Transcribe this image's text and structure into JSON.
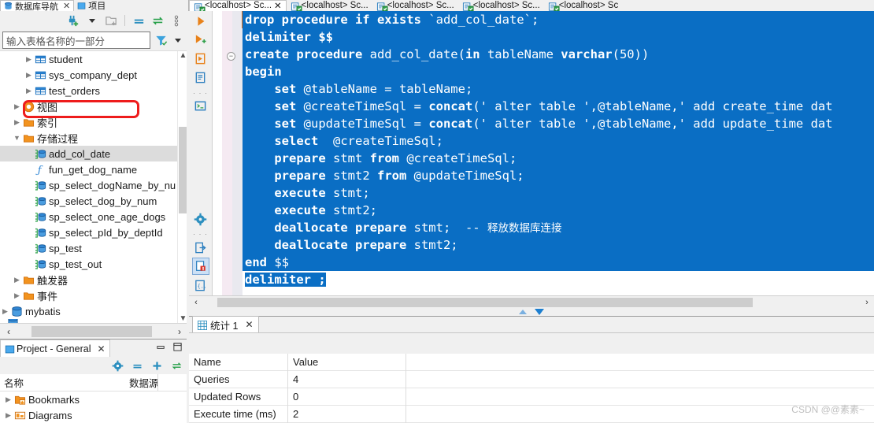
{
  "window": {
    "watermark": "CSDN @@素素~"
  },
  "db_navigator": {
    "tabs": [
      {
        "label": "数据库导航",
        "icon": "database-navigator-icon",
        "active": true,
        "closable": true
      },
      {
        "label": "项目",
        "icon": "project-icon",
        "active": false,
        "closable": false
      }
    ],
    "toolbar": [
      {
        "name": "new-connection-icon",
        "glyph": "plug-plus"
      },
      {
        "name": "dropdown-arrow-icon",
        "glyph": "caret-down"
      },
      {
        "name": "new-folder-icon",
        "glyph": "folder-plus"
      },
      {
        "name": "collapse-all-icon",
        "glyph": "minus-bars"
      },
      {
        "name": "refresh-icon",
        "glyph": "swap-arrows"
      },
      {
        "name": "view-menu-icon",
        "glyph": "vertical-dots"
      }
    ],
    "filter": {
      "placeholder": "输入表格名称的一部分",
      "value": "",
      "filter_icon": "funnel-icon",
      "dropdown_icon": "caret-down-icon"
    },
    "tree": [
      {
        "label": "student",
        "indent": 3,
        "arrow": "closed",
        "icon": "table-icon",
        "selected": false
      },
      {
        "label": "sys_company_dept",
        "indent": 3,
        "arrow": "closed",
        "icon": "table-icon",
        "selected": false
      },
      {
        "label": "test_orders",
        "indent": 3,
        "arrow": "closed",
        "icon": "table-icon",
        "selected": false
      },
      {
        "label": "视图",
        "indent": 2,
        "arrow": "closed",
        "icon": "view-icon",
        "selected": false
      },
      {
        "label": "索引",
        "indent": 2,
        "arrow": "closed",
        "icon": "folder-icon",
        "selected": false
      },
      {
        "label": "存储过程",
        "indent": 2,
        "arrow": "open",
        "icon": "folder-icon",
        "selected": false
      },
      {
        "label": "add_col_date",
        "indent": 3,
        "arrow": "none",
        "icon": "procedure-icon",
        "selected": true
      },
      {
        "label": "fun_get_dog_name",
        "indent": 3,
        "arrow": "none",
        "icon": "function-icon",
        "selected": false
      },
      {
        "label": "sp_select_dogName_by_nu",
        "indent": 3,
        "arrow": "none",
        "icon": "procedure-icon",
        "selected": false
      },
      {
        "label": "sp_select_dog_by_num",
        "indent": 3,
        "arrow": "none",
        "icon": "procedure-icon",
        "selected": false
      },
      {
        "label": "sp_select_one_age_dogs",
        "indent": 3,
        "arrow": "none",
        "icon": "procedure-icon",
        "selected": false
      },
      {
        "label": "sp_select_pId_by_deptId",
        "indent": 3,
        "arrow": "none",
        "icon": "procedure-icon",
        "selected": false
      },
      {
        "label": "sp_test",
        "indent": 3,
        "arrow": "none",
        "icon": "procedure-icon",
        "selected": false
      },
      {
        "label": "sp_test_out",
        "indent": 3,
        "arrow": "none",
        "icon": "procedure-icon",
        "selected": false
      },
      {
        "label": "触发器",
        "indent": 2,
        "arrow": "closed",
        "icon": "folder-icon",
        "selected": false
      },
      {
        "label": "事件",
        "indent": 2,
        "arrow": "closed",
        "icon": "folder-icon",
        "selected": false
      },
      {
        "label": "mybatis",
        "indent": 1,
        "arrow": "closed",
        "icon": "database-icon",
        "selected": false
      }
    ]
  },
  "project_panel": {
    "tab": {
      "label": "Project - General",
      "icon": "project-icon",
      "closable": true
    },
    "window_buttons": [
      {
        "name": "minimize-button",
        "glyph": "minimize"
      },
      {
        "name": "maximize-button",
        "glyph": "maximize"
      }
    ],
    "toolbar": [
      {
        "name": "settings-gear-icon",
        "glyph": "gear"
      },
      {
        "name": "collapse-all-icon",
        "glyph": "minus-bars"
      },
      {
        "name": "add-icon",
        "glyph": "plus"
      },
      {
        "name": "refresh-icon",
        "glyph": "swap-arrows"
      }
    ],
    "columns": [
      "名称",
      "数据源"
    ],
    "rows": [
      {
        "label": "Bookmarks",
        "arrow": "closed",
        "icon": "bookmarks-folder-icon"
      },
      {
        "label": "Diagrams",
        "arrow": "closed",
        "icon": "diagrams-icon"
      }
    ]
  },
  "editor": {
    "tabs": [
      {
        "label": "<localhost> Sc...",
        "icon": "sql-editor-icon",
        "active": true,
        "closable": true
      },
      {
        "label": "<localhost> Sc...",
        "icon": "sql-editor-icon",
        "active": false,
        "closable": false
      },
      {
        "label": "<localhost> Sc...",
        "icon": "sql-editor-icon",
        "active": false,
        "closable": false
      },
      {
        "label": "<localhost> Sc...",
        "icon": "sql-editor-icon",
        "active": false,
        "closable": false
      },
      {
        "label": "<localhost> Sc",
        "icon": "sql-editor-icon",
        "active": false,
        "closable": false
      }
    ],
    "vertical_toolbar": [
      {
        "name": "execute-statement-icon",
        "glyph": "play"
      },
      {
        "name": "execute-script-icon",
        "glyph": "play-plus"
      },
      {
        "name": "execute-in-new-tab-icon",
        "glyph": "play-doc"
      },
      {
        "name": "explain-plan-icon",
        "glyph": "doc-lines"
      },
      {
        "name": "toolbar-separator",
        "glyph": "dots"
      },
      {
        "name": "open-console-icon",
        "glyph": "terminal"
      },
      {
        "name": "settings-gear-icon",
        "glyph": "gear"
      },
      {
        "name": "toolbar-separator-2",
        "glyph": "dots"
      },
      {
        "name": "export-data-icon",
        "glyph": "doc-arrow"
      },
      {
        "name": "sql-error-doc-icon",
        "glyph": "doc-error"
      },
      {
        "name": "script-doc-icon",
        "glyph": "doc-brace"
      }
    ],
    "selection_color": "#0a6ec4",
    "lines": [
      {
        "n": 1,
        "selected": true,
        "tokens": [
          {
            "t": "drop procedure if exists ",
            "k": true
          },
          {
            "t": "`add_col_date`;",
            "k": false
          }
        ]
      },
      {
        "n": 2,
        "selected": true,
        "tokens": [
          {
            "t": "delimiter $$",
            "k": true
          }
        ]
      },
      {
        "n": 3,
        "selected": true,
        "tokens": [
          {
            "t": "create procedure ",
            "k": true
          },
          {
            "t": "add_col_date(",
            "k": false
          },
          {
            "t": "in",
            "k": true
          },
          {
            "t": " tableName ",
            "k": false
          },
          {
            "t": "varchar",
            "k": true
          },
          {
            "t": "(50))",
            "k": false
          }
        ]
      },
      {
        "n": 4,
        "selected": true,
        "tokens": [
          {
            "t": "begin",
            "k": true
          }
        ]
      },
      {
        "n": 5,
        "selected": true,
        "tokens": [
          {
            "t": "    set",
            "k": true
          },
          {
            "t": " @tableName = tableName;",
            "k": false
          }
        ]
      },
      {
        "n": 6,
        "selected": true,
        "tokens": [
          {
            "t": "    set",
            "k": true
          },
          {
            "t": " @createTimeSql = ",
            "k": false
          },
          {
            "t": "concat",
            "k": true
          },
          {
            "t": "(' alter table ',@tableName,' add create_time dat",
            "k": false
          }
        ]
      },
      {
        "n": 7,
        "selected": true,
        "tokens": [
          {
            "t": "    set",
            "k": true
          },
          {
            "t": " @updateTimeSql = ",
            "k": false
          },
          {
            "t": "concat",
            "k": true
          },
          {
            "t": "(' alter table ',@tableName,' add update_time dat",
            "k": false
          }
        ]
      },
      {
        "n": 8,
        "selected": true,
        "tokens": [
          {
            "t": "    select",
            "k": true
          },
          {
            "t": "  @createTimeSql;",
            "k": false
          }
        ]
      },
      {
        "n": 9,
        "selected": true,
        "tokens": [
          {
            "t": "    prepare",
            "k": true
          },
          {
            "t": " stmt ",
            "k": false
          },
          {
            "t": "from",
            "k": true
          },
          {
            "t": " @createTimeSql;",
            "k": false
          }
        ]
      },
      {
        "n": 10,
        "selected": true,
        "tokens": [
          {
            "t": "    prepare",
            "k": true
          },
          {
            "t": " stmt2 ",
            "k": false
          },
          {
            "t": "from",
            "k": true
          },
          {
            "t": " @updateTimeSql;",
            "k": false
          }
        ]
      },
      {
        "n": 11,
        "selected": true,
        "tokens": [
          {
            "t": "    execute",
            "k": true
          },
          {
            "t": " stmt;",
            "k": false
          }
        ]
      },
      {
        "n": 12,
        "selected": true,
        "tokens": [
          {
            "t": "    execute",
            "k": true
          },
          {
            "t": " stmt2;",
            "k": false
          }
        ]
      },
      {
        "n": 13,
        "selected": true,
        "tokens": [
          {
            "t": "    deallocate prepare",
            "k": true
          },
          {
            "t": " stmt;  -- ",
            "k": false
          },
          {
            "t": "释放数据库连接",
            "k": false,
            "c": true
          }
        ]
      },
      {
        "n": 14,
        "selected": true,
        "tokens": [
          {
            "t": "    deallocate prepare",
            "k": true
          },
          {
            "t": " stmt2;",
            "k": false
          }
        ]
      },
      {
        "n": 15,
        "selected": true,
        "tokens": [
          {
            "t": "end ",
            "k": true
          },
          {
            "t": "$$",
            "k": false
          }
        ]
      },
      {
        "n": 16,
        "selected": "partial",
        "tokens": [
          {
            "t": "delimiter ;",
            "k": true
          }
        ]
      }
    ]
  },
  "results": {
    "tab": {
      "label": "统计 1",
      "icon": "grid-icon",
      "closable": true
    },
    "columns": [
      "Name",
      "Value"
    ],
    "rows": [
      {
        "name": "Queries",
        "value": "4"
      },
      {
        "name": "Updated Rows",
        "value": "0"
      },
      {
        "name": "Execute time (ms)",
        "value": "2"
      }
    ]
  }
}
